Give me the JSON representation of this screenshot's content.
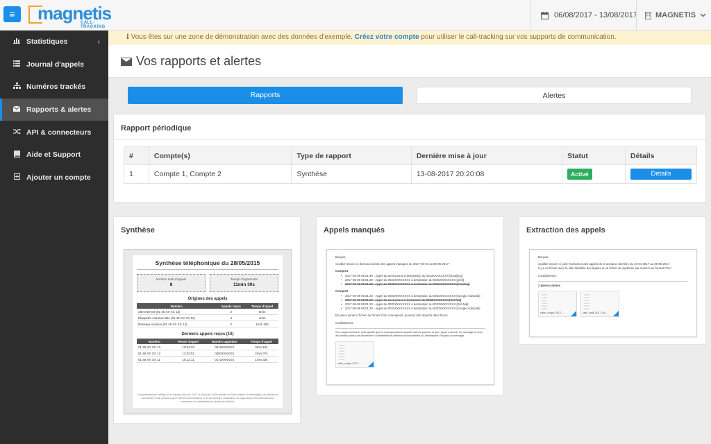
{
  "header": {
    "menu_icon": "hamburger-icon",
    "logo_text": "magnetis",
    "logo_sub": "CALL-TRACKING",
    "date_range": "06/08/2017 - 13/08/2017",
    "account_name": "MAGNETIS"
  },
  "sidebar": {
    "items": [
      {
        "label": "Statistiques",
        "icon": "bar-chart-icon"
      },
      {
        "label": "Journal d'appels",
        "icon": "list-icon"
      },
      {
        "label": "Numéros trackés",
        "icon": "sitemap-icon"
      },
      {
        "label": "Rapports & alertes",
        "icon": "envelope-icon"
      },
      {
        "label": "API & connecteurs",
        "icon": "shuffle-icon"
      },
      {
        "label": "Aide et Support",
        "icon": "book-icon"
      },
      {
        "label": "Ajouter un compte",
        "icon": "plus-square-icon"
      }
    ],
    "active_index": 3
  },
  "banner": {
    "text_before": "Vous êtes sur une zone de démonstration avec des données d'exemple.",
    "link": "Créez votre compte",
    "text_after": "pour utiliser le call-tracking sur vos supports de communication."
  },
  "page": {
    "title": "Vos rapports et alertes"
  },
  "tabs": {
    "rapports": "Rapports",
    "alertes": "Alertes"
  },
  "periodique": {
    "title": "Rapport périodique",
    "columns": [
      "#",
      "Compte(s)",
      "Type de rapport",
      "Dernière mise à jour",
      "Statut",
      "Détails"
    ],
    "rows": [
      {
        "num": "1",
        "comptes": "Compte 1, Compte 2",
        "type": "Synthèse",
        "maj": "13-08-2017 20:20:08",
        "statut": "Activé",
        "details": "Détails"
      }
    ]
  },
  "previews": {
    "synthese": {
      "title": "Synthèse",
      "doc_title": "Synthèse téléphonique du 28/05/2015",
      "box1_label": "Nombre total d'appels",
      "box1_value": "8",
      "box2_label": "Temps d'appel total",
      "box2_value": "11min 30s",
      "origines_title": "Origines des appels",
      "origines_cols": [
        "Numéro",
        "Appels reçus",
        "Temps d'appel"
      ],
      "origines_rows": [
        [
          "Site Internet (01 45 XX XX 13)",
          "2",
          "6min"
        ],
        [
          "Plaquette commerciale (01 45 XX XX 11)",
          "4",
          "4min"
        ],
        [
          "Réseaux sociaux (01 45 XX XX 12)",
          "2",
          "1min 30s"
        ]
      ],
      "derniers_title": "Derniers appels reçus (10)",
      "derniers_cols": [
        "Numéro",
        "Heure d'appel",
        "Numéro appelant",
        "Temps d'appel"
      ],
      "derniers_rows": [
        [
          "01 45 XX XX 13",
          "10:04:32",
          "0616XXXXXX",
          "3min 18s"
        ],
        [
          "01 45 XX XX 13",
          "12:32:01",
          "0493XXXXXX",
          "2min 07s"
        ],
        [
          "01 45 XX XX 11",
          "15:12:11",
          "0172XXXXXX",
          "1min 33s"
        ]
      ],
      "footer": "Conformément aux articles 39 et suivants de la loi 78-17 du 6 janvier 1978 modifiée en 2004 relative à l'informatique, aux fichiers et aux libertés, toute personne peut obtenir communication et, le cas échéant, rectification ou suppression des informations la concernant, en s'adressant au service de l'éditeur."
    },
    "manques": {
      "title": "Appels manqués",
      "greeting": "Bonjour,",
      "intro": "veuillez trouver ci-dessous la liste des appels manqués du 2017-05-03 au 09-05-2017 :",
      "compte1": "Compte1",
      "compte1_lines": [
        "2017-05-09 05:01:40 - Appel du anonymous à destination du 0033XXXXXXXX [Emailing]",
        "2017-05-09 05:01:20 - Appel du 0033XXXXXXXX à destination du 0033XXXXXXXX [print]",
        "2017-05-09 05:01:20 - Appel du 0033XXXXXXXX à destination du 0033XXXXXXXX [Emailing]"
      ],
      "compte2": "Compte2",
      "compte2_lines": [
        "2017-05-09 05:01:20 - Appel du 0033XXXXXXXX à destination du 0033XXXXXXXX [Google Adwords]",
        "2017-05-09 05:01:20 - Appel du anonymous à destination du 0033XXXXXXXX [Ref Nat]",
        "2017-05-09 05:01:20 - Appel du 0033XXXXXXXX à destination du 0033XXXXXXXX [Ref Nat]",
        "2017-05-09 05:01:20 - Appel du 0033XXXXXXXX à destination du 0033XXXXXXXX [Google Adwords]"
      ],
      "csv_note": "En pièce jointe le fichier au format CSV correspond, pouvant être importé dans Excel.",
      "closing": "Cordialement,",
      "notes": "Si un appel est barré, cela signifie que le correspondant a rappelé dans la journée et que l'appel a abouti. Ce message et tous les fichiers joints sont strictement confidentiels et destinés exclusivement au destinataire d'origine du message.",
      "attachment": "calls_origin-2017-..."
    },
    "extraction": {
      "title": "Extraction des appels",
      "greeting": "Bonjour,",
      "line1": "veuillez trouver ci-joint l'extraction des appels de la semaine dernière du 10-04-2017 au 09-05-2017.",
      "line2": "Il y a un fichier avec la liste détaillée des appels et un fichier de synthèse par numéro au format CSV.",
      "closing": "Cordialement,",
      "attachments_label": "2 pièces jointes",
      "attachment1": "calls_origin-2017-...",
      "attachment2": "last_calls-2017-04-..."
    }
  }
}
